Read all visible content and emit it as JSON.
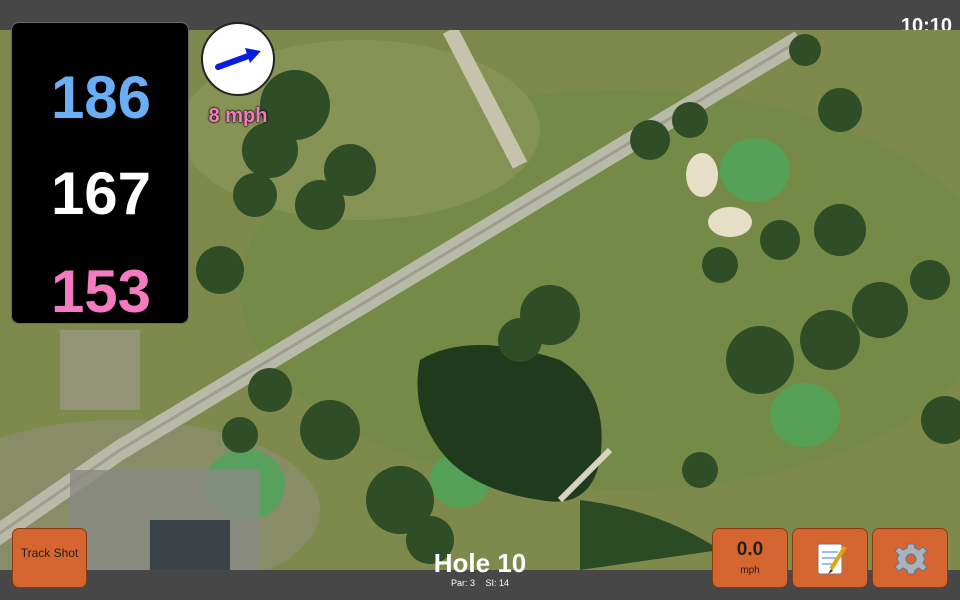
{
  "status": {
    "time": "10:10"
  },
  "distances": {
    "back": "186",
    "middle": "167",
    "front": "153"
  },
  "wind": {
    "speed": "8 mph",
    "icon": "wind-arrow-icon"
  },
  "hole": {
    "title": "Hole 10",
    "par": "Par: 3",
    "si": "SI: 14"
  },
  "buttons": {
    "track_shot": "Track Shot",
    "speed_value": "0.0",
    "speed_unit": "mph",
    "notes_icon": "notepad-icon",
    "settings_icon": "gear-icon"
  },
  "colors": {
    "back": "#6aaef5",
    "middle": "#ffffff",
    "front": "#f47ac1",
    "button": "#d5662f",
    "wind_arrow": "#0a1ee0"
  }
}
